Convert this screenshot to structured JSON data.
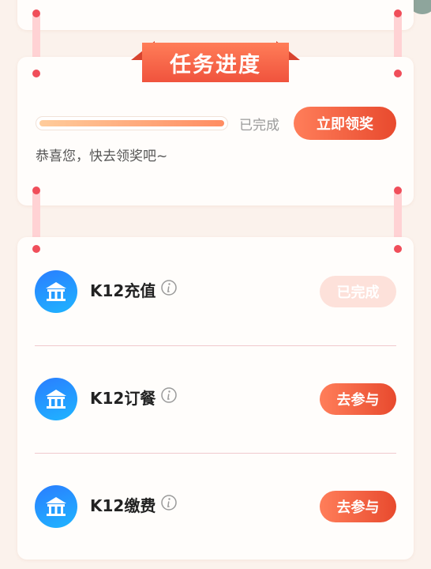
{
  "header": {
    "title": "任务进度"
  },
  "progress": {
    "fraction": 1.0,
    "status": "已完成",
    "claim_label": "立即领奖",
    "message": "恭喜您，快去领奖吧~"
  },
  "tasks": [
    {
      "title": "K12充值",
      "button_label": "已完成",
      "completed": true
    },
    {
      "title": "K12订餐",
      "button_label": "去参与",
      "completed": false
    },
    {
      "title": "K12缴费",
      "button_label": "去参与",
      "completed": false
    }
  ],
  "icons": {
    "task": "bank-icon",
    "info": "info-icon"
  },
  "colors": {
    "accent": "#f0533d",
    "task_icon_blue": "#1fb5ff",
    "rope": "#ffd2d4",
    "pin": "#f04e5a"
  }
}
